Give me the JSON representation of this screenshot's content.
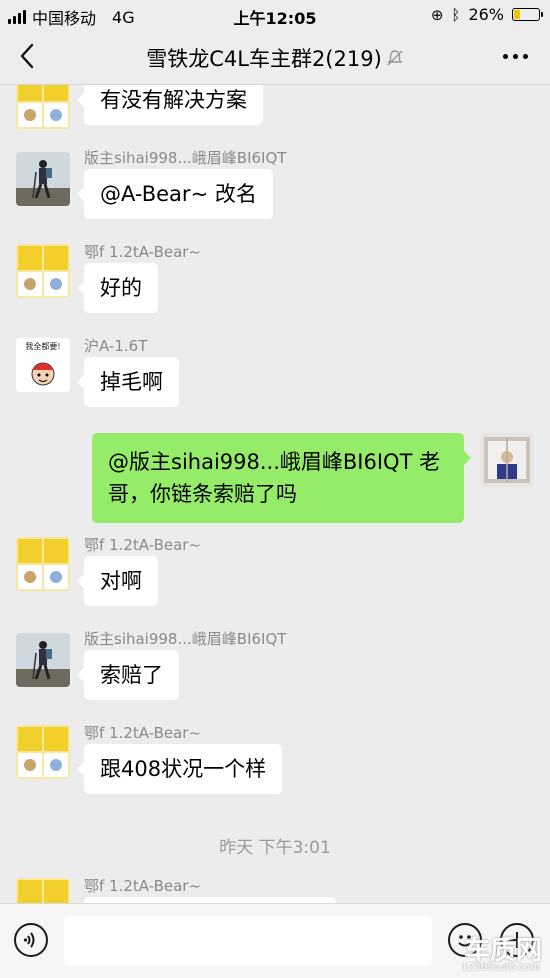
{
  "status_bar": {
    "carrier": "中国移动",
    "network": "4G",
    "time": "上午12:05",
    "battery": "26%",
    "battery_level": 0.26
  },
  "nav": {
    "title": "雪铁龙C4L车主群2(219)"
  },
  "messages": [
    {
      "sender": "",
      "text": "有没有解决方案",
      "avatar": "yellow-collage"
    },
    {
      "sender": "版主sihai998...峨眉峰BI6IQT",
      "text": "@A-Bear~ 改名",
      "avatar": "hiker"
    },
    {
      "sender": "鄂f 1.2tA-Bear~",
      "text": "好的",
      "avatar": "yellow-collage"
    },
    {
      "sender": "沪A-1.6T",
      "text": "掉毛啊",
      "avatar": "cartoon",
      "avatar_caption": "我全都要!"
    },
    {
      "sender": "",
      "text": "@版主sihai998...峨眉峰BI6IQT 老哥，你链条索赔了吗",
      "avatar": "me-window",
      "outgoing": true
    },
    {
      "sender": "鄂f 1.2tA-Bear~",
      "text": "对啊",
      "avatar": "yellow-collage"
    },
    {
      "sender": "版主sihai998...峨眉峰BI6IQT",
      "text": "索赔了",
      "avatar": "hiker"
    },
    {
      "sender": "鄂f 1.2tA-Bear~",
      "text": "跟408状况一个样",
      "avatar": "yellow-collage"
    },
    {
      "sender": "鄂f 1.2tA-Bear~",
      "text": "",
      "avatar": "yellow-collage"
    }
  ],
  "timestamp": "昨天  下午3:01",
  "input": {
    "placeholder": ""
  },
  "watermark": {
    "main": "车质网",
    "sub": "12365auto.com"
  },
  "colors": {
    "outgoing_bubble": "#95ec69",
    "incoming_bubble": "#ffffff",
    "background": "#ececec"
  }
}
